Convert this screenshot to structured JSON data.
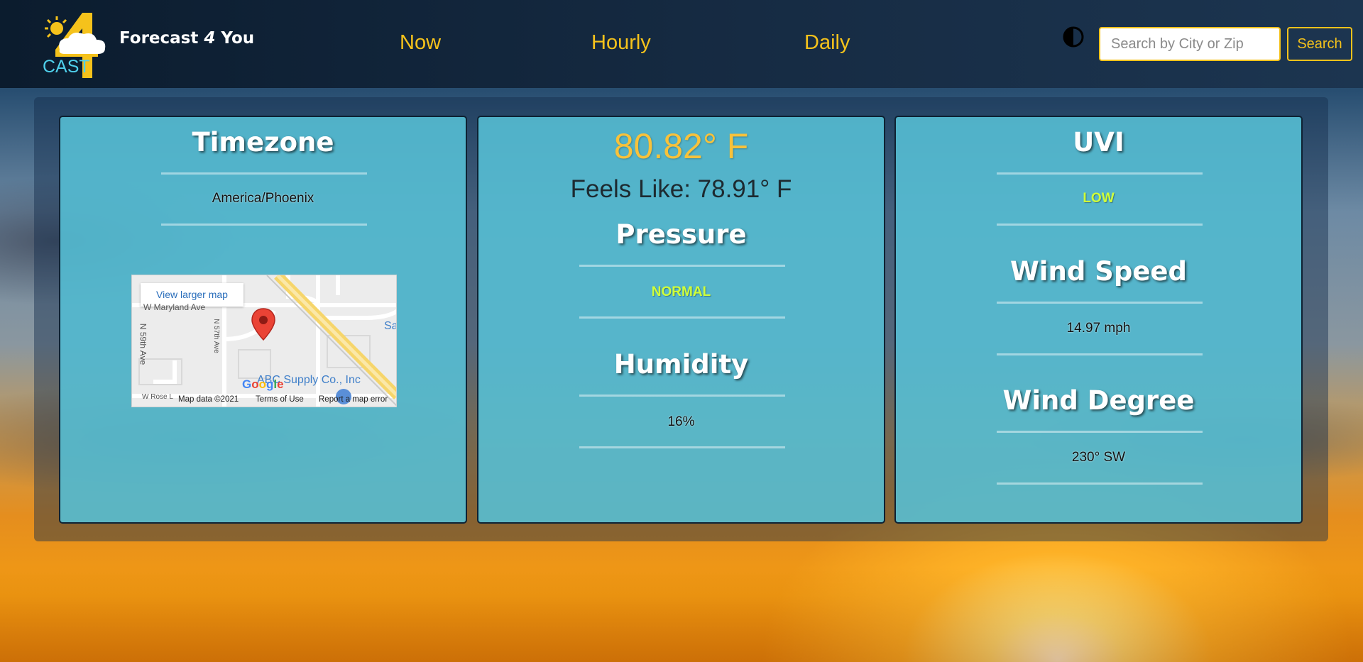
{
  "header": {
    "logo_text": "CAST",
    "brand_prefix": "Forecast ",
    "brand_four": "4",
    "brand_suffix": " You",
    "nav": [
      "Now",
      "Hourly",
      "Daily"
    ],
    "theme_icon": "contrast-icon",
    "search_placeholder": "Search by City or Zip",
    "search_button": "Search"
  },
  "timezone": {
    "title": "Timezone",
    "value": "America/Phoenix"
  },
  "map": {
    "view_larger": "View larger map",
    "streets": [
      "W Maryland Ave",
      "N 59th Ave",
      "N 57th Ave",
      "W Rose L"
    ],
    "poi": "ABC Supply Co., Inc",
    "poi_partial": "Sa",
    "google": "Google",
    "footer": [
      "Map data ©2021",
      "Terms of Use",
      "Report a map error"
    ],
    "marker_icon": "map-pin-icon"
  },
  "current": {
    "temperature": "80.82° F",
    "feels_like": "Feels Like: 78.91° F",
    "pressure_title": "Pressure",
    "pressure_value": "NORMAL",
    "humidity_title": "Humidity",
    "humidity_value": "16%"
  },
  "conditions": {
    "uvi_title": "UVI",
    "uvi_value": "LOW",
    "wind_speed_title": "Wind Speed",
    "wind_speed_value": "14.97 mph",
    "wind_degree_title": "Wind Degree",
    "wind_degree_value": "230° SW"
  },
  "colors": {
    "accent": "#f5c21b",
    "card_bg": "#56c0d6",
    "status_good": "#cfff3a",
    "temperature": "#f7c23b"
  }
}
